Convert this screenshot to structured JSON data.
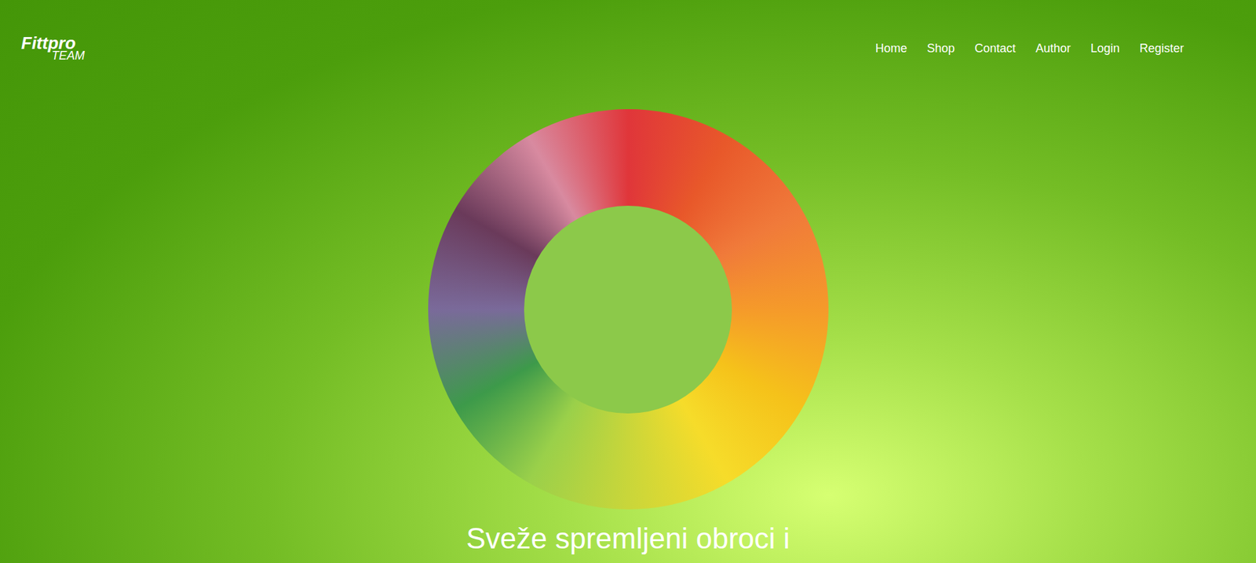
{
  "logo": {
    "line1": "Fittpro",
    "line2": "TEAM"
  },
  "nav": [
    {
      "label": "Home"
    },
    {
      "label": "Shop"
    },
    {
      "label": "Contact"
    },
    {
      "label": "Author"
    },
    {
      "label": "Login"
    },
    {
      "label": "Register"
    }
  ],
  "hero": {
    "heading": "Sveže spremljeni obroci i"
  }
}
